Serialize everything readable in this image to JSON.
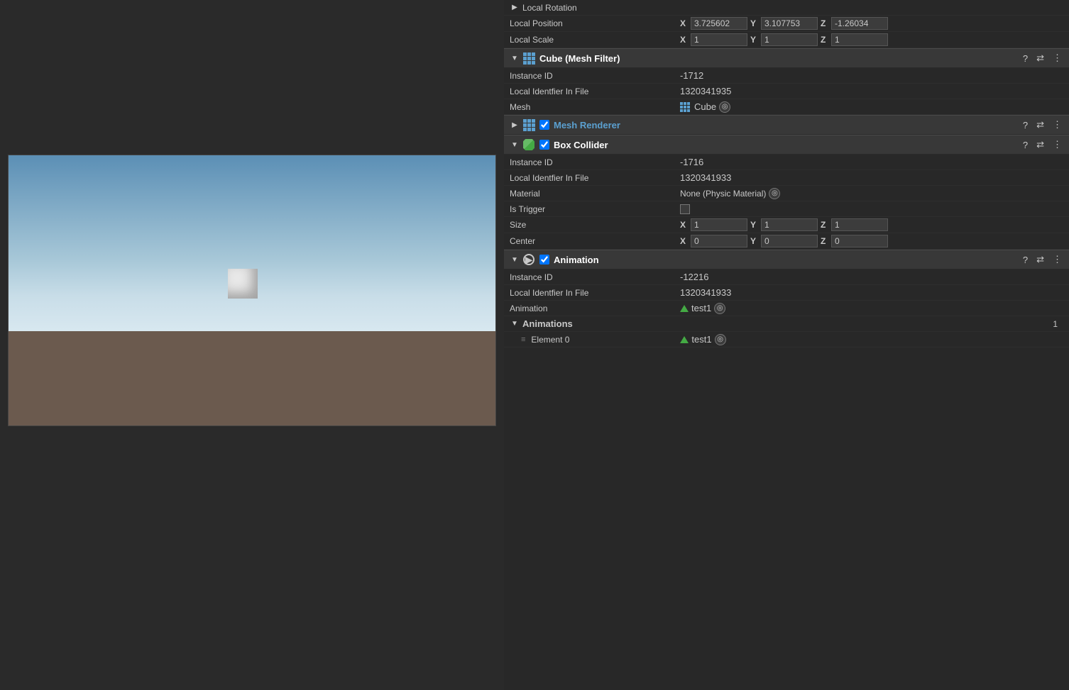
{
  "scene": {
    "label": "Scene Viewport"
  },
  "transform": {
    "local_rotation_label": "Local Rotation",
    "local_position_label": "Local Position",
    "local_position_x": "3.725602",
    "local_position_y": "3.107753",
    "local_position_z": "-1.26034",
    "local_scale_label": "Local Scale",
    "local_scale_x": "1",
    "local_scale_y": "1",
    "local_scale_z": "1"
  },
  "mesh_filter": {
    "title": "Cube (Mesh Filter)",
    "instance_id_label": "Instance ID",
    "instance_id_value": "-1712",
    "local_identfier_label": "Local Identfier In File",
    "local_identfier_value": "1320341935",
    "mesh_label": "Mesh",
    "mesh_value": "Cube"
  },
  "mesh_renderer": {
    "title": "Mesh Renderer"
  },
  "box_collider": {
    "title": "Box Collider",
    "instance_id_label": "Instance ID",
    "instance_id_value": "-1716",
    "local_identfier_label": "Local Identfier In File",
    "local_identfier_value": "1320341933",
    "material_label": "Material",
    "material_value": "None (Physic Material)",
    "is_trigger_label": "Is Trigger",
    "size_label": "Size",
    "size_x": "1",
    "size_y": "1",
    "size_z": "1",
    "center_label": "Center",
    "center_x": "0",
    "center_y": "0",
    "center_z": "0"
  },
  "animation": {
    "title": "Animation",
    "instance_id_label": "Instance ID",
    "instance_id_value": "-12216",
    "local_identfier_label": "Local Identfier In File",
    "local_identfier_value": "1320341933",
    "animation_label": "Animation",
    "animation_value": "test1",
    "animations_label": "Animations",
    "animations_count": "1",
    "element_0_label": "Element 0",
    "element_0_value": "test1"
  }
}
